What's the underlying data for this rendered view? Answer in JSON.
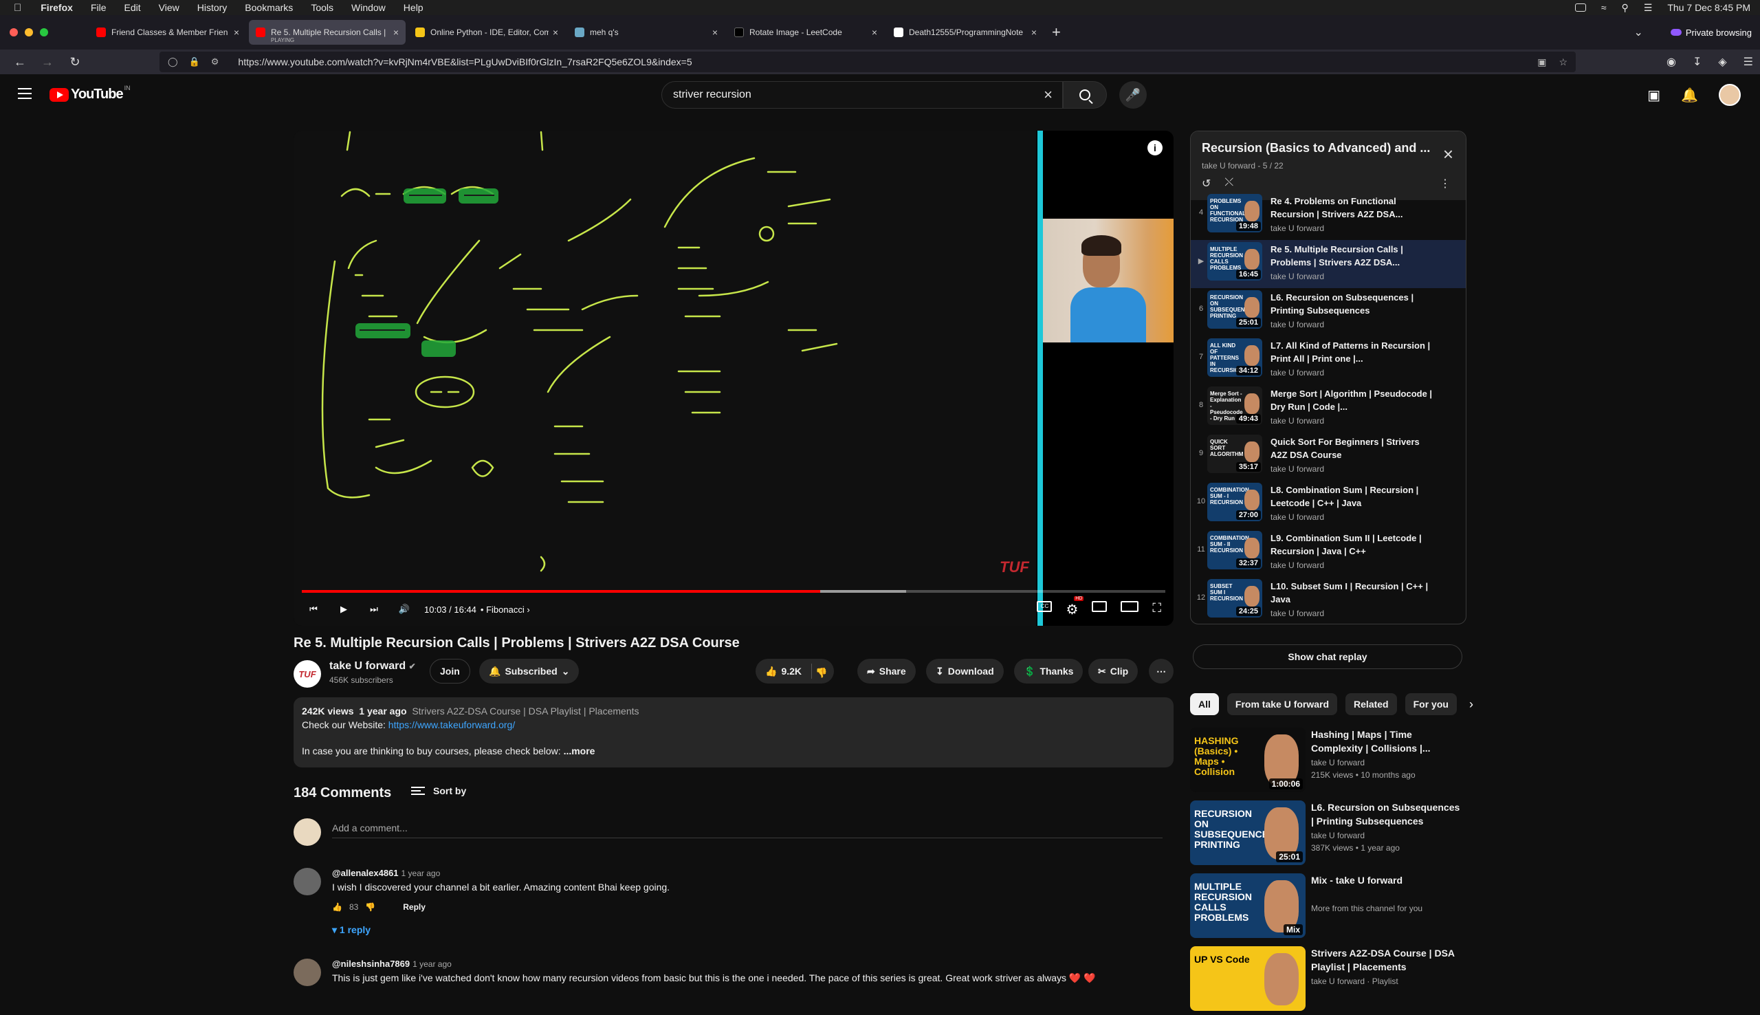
{
  "macbar": {
    "app": "Firefox",
    "menus": [
      "File",
      "Edit",
      "View",
      "History",
      "Bookmarks",
      "Tools",
      "Window",
      "Help"
    ],
    "clock": "Thu 7 Dec  8:45 PM"
  },
  "tabs": [
    {
      "title": "Friend Classes & Member Frien",
      "favicon_color": "#ff0000",
      "active": false
    },
    {
      "title": "Re 5. Multiple Recursion Calls |",
      "sub": "PLAYING",
      "favicon_color": "#ff0000",
      "active": true
    },
    {
      "title": "Online Python - IDE, Editor, Com",
      "favicon_color": "#f5c518",
      "active": false
    },
    {
      "title": "meh q's",
      "favicon_color": "#6aa8c5",
      "active": false
    },
    {
      "title": "Rotate Image - LeetCode",
      "favicon_color": "#000000",
      "active": false
    },
    {
      "title": "Death12555/ProgrammingNote",
      "favicon_color": "#ffffff",
      "active": false
    }
  ],
  "private_label": "Private browsing",
  "url": "https://www.youtube.com/watch?v=kvRjNm4rVBE&list=PLgUwDviBIf0rGlzIn_7rsaR2FQ5e6ZOL9&index=5",
  "search": {
    "query": "striver recursion"
  },
  "logo_word": "YouTube",
  "logo_cc": "IN",
  "player": {
    "time": "10:03 / 16:44",
    "chapter": "Fibonacci",
    "watermark": "TUF",
    "played_fraction": 0.6,
    "buffered_fraction": 0.7,
    "hd": "HD"
  },
  "video": {
    "title": "Re 5. Multiple Recursion Calls | Problems | Strivers A2Z DSA Course",
    "channel": "take U forward",
    "subscribers": "456K subscribers",
    "channel_logo": "TUF",
    "join": "Join",
    "subscribed": "Subscribed",
    "likes": "9.2K",
    "share": "Share",
    "download": "Download",
    "thanks": "Thanks",
    "clip": "Clip",
    "views": "242K views",
    "ago": "1 year ago",
    "tags": "Strivers A2Z-DSA Course | DSA Playlist | Placements",
    "website_label": "Check our Website:",
    "website": "https://www.takeuforward.org/",
    "desc_line": "In case you are thinking to buy courses, please check below:",
    "more": "...more"
  },
  "comments": {
    "count": "184 Comments",
    "sort": "Sort by",
    "placeholder": "Add a comment...",
    "items": [
      {
        "author": "@allenalex4861",
        "ago": "1 year ago",
        "text": "I wish I discovered your channel a bit earlier. Amazing content Bhai keep going.",
        "likes": "83",
        "reply": "Reply",
        "replies": "1 reply"
      },
      {
        "author": "@nileshsinha7869",
        "ago": "1 year ago",
        "text": "This is just gem like i've watched don't know how many recursion videos from basic but this is the one i needed. The pace of this series is great. Great work striver as always ❤️ ❤️"
      }
    ]
  },
  "playlist": {
    "title": "Recursion (Basics to Advanced) and ...",
    "sub": "take U forward - 5 / 22",
    "items": [
      {
        "idx": "4",
        "title": "Re 4. Problems on Functional Recursion | Strivers A2Z DSA...",
        "channel": "take U forward",
        "duration": "19:48",
        "thumb": "PROBLEMS ON FUNCTIONAL RECURSION",
        "bg": "#123d6b"
      },
      {
        "idx": "▶",
        "title": "Re 5. Multiple Recursion Calls | Problems | Strivers A2Z DSA...",
        "channel": "take U forward",
        "duration": "16:45",
        "thumb": "MULTIPLE RECURSION CALLS PROBLEMS",
        "bg": "#123d6b",
        "current": true
      },
      {
        "idx": "6",
        "title": "L6. Recursion on Subsequences | Printing Subsequences",
        "channel": "take U forward",
        "duration": "25:01",
        "thumb": "RECURSION ON SUBSEQUENCES PRINTING",
        "bg": "#123d6b"
      },
      {
        "idx": "7",
        "title": "L7. All Kind of Patterns in Recursion | Print All | Print one |...",
        "channel": "take U forward",
        "duration": "34:12",
        "thumb": "ALL KIND OF PATTERNS IN RECURSION",
        "bg": "#123d6b"
      },
      {
        "idx": "8",
        "title": "Merge Sort | Algorithm | Pseudocode | Dry Run | Code |...",
        "channel": "take U forward",
        "duration": "49:43",
        "thumb": "Merge Sort - Explanation - Pseudocode - Dry Run",
        "bg": "#1a1a1a"
      },
      {
        "idx": "9",
        "title": "Quick Sort For Beginners | Strivers A2Z DSA Course",
        "channel": "take U forward",
        "duration": "35:17",
        "thumb": "QUICK SORT ALGORITHM",
        "bg": "#1a1a1a"
      },
      {
        "idx": "10",
        "title": "L8. Combination Sum | Recursion | Leetcode | C++ | Java",
        "channel": "take U forward",
        "duration": "27:00",
        "thumb": "COMBINATION SUM - I RECURSION",
        "bg": "#123d6b"
      },
      {
        "idx": "11",
        "title": "L9. Combination Sum II | Leetcode | Recursion | Java | C++",
        "channel": "take U forward",
        "duration": "32:37",
        "thumb": "COMBINATION SUM - II RECURSION",
        "bg": "#123d6b"
      },
      {
        "idx": "12",
        "title": "L10. Subset Sum I | Recursion | C++ | Java",
        "channel": "take U forward",
        "duration": "24:25",
        "thumb": "SUBSET SUM I RECURSION",
        "bg": "#123d6b"
      }
    ]
  },
  "chat_replay": "Show chat replay",
  "chips": [
    "All",
    "From take U forward",
    "Related",
    "For you"
  ],
  "recommendations": [
    {
      "title": "Hashing | Maps | Time Complexity | Collisions |...",
      "channel": "take U forward",
      "meta": "215K views • 10 months ago",
      "duration": "1:00:06",
      "thumb": "HASHING (Basics) • Maps • Collision",
      "bg": "#0d0d0d",
      "tcolor": "#f5c518"
    },
    {
      "title": "L6. Recursion on Subsequences | Printing Subsequences",
      "channel": "take U forward",
      "meta": "387K views • 1 year ago",
      "duration": "25:01",
      "thumb": "RECURSION ON SUBSEQUENCES PRINTING",
      "bg": "#123d6b",
      "tcolor": "#ffffff"
    },
    {
      "title": "Mix - take U forward",
      "channel": "More from this channel for you",
      "meta": "",
      "duration": "Mix",
      "thumb": "MULTIPLE RECURSION CALLS PROBLEMS",
      "bg": "#123d6b",
      "tcolor": "#ffffff"
    },
    {
      "title": "Strivers A2Z-DSA Course | DSA Playlist | Placements",
      "channel": "take U forward · Playlist",
      "meta": "",
      "duration": "",
      "thumb": "UP VS Code",
      "bg": "#f5c518",
      "tcolor": "#000000"
    }
  ]
}
